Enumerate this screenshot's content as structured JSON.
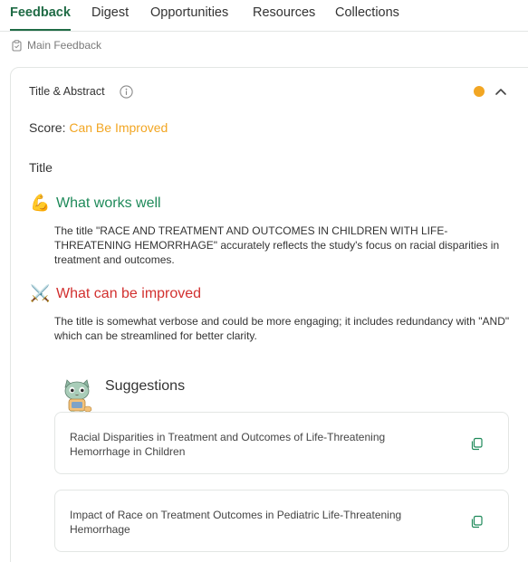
{
  "tabs": [
    {
      "label": "Feedback",
      "active": true
    },
    {
      "label": "Digest",
      "active": false
    },
    {
      "label": "Opportunities",
      "active": false
    },
    {
      "label": "Resources",
      "active": false
    },
    {
      "label": "Collections",
      "active": false
    }
  ],
  "breadcrumb": {
    "label": "Main Feedback",
    "icon": "clipboard-icon"
  },
  "section": {
    "title": "Title & Abstract",
    "status_color": "#f2a623",
    "score_label": "Score:",
    "score_value": "Can Be Improved",
    "score_color": "#f2a623",
    "subheading": "Title",
    "works_well": {
      "emoji": "💪",
      "heading": "What works well",
      "color": "#1f8a5a",
      "text": "The title \"RACE AND TREATMENT AND OUTCOMES IN CHILDREN WITH LIFE-THREATENING HEMORRHAGE\" accurately reflects the study's focus on racial disparities in treatment and outcomes."
    },
    "improve": {
      "emoji": "⚔️",
      "heading": "What can be improved",
      "color": "#d2302f",
      "text": "The title is somewhat verbose and could be more engaging; it includes redundancy with \"AND\" which can be streamlined for better clarity."
    },
    "suggestions": {
      "heading": "Suggestions",
      "items": [
        {
          "text": "Racial Disparities in Treatment and Outcomes of Life-Threatening Hemorrhage in Children"
        },
        {
          "text": "Impact of Race on Treatment Outcomes in Pediatric Life-Threatening Hemorrhage"
        }
      ]
    }
  },
  "colors": {
    "brand": "#1f6b45",
    "border": "#e3e6e4"
  }
}
